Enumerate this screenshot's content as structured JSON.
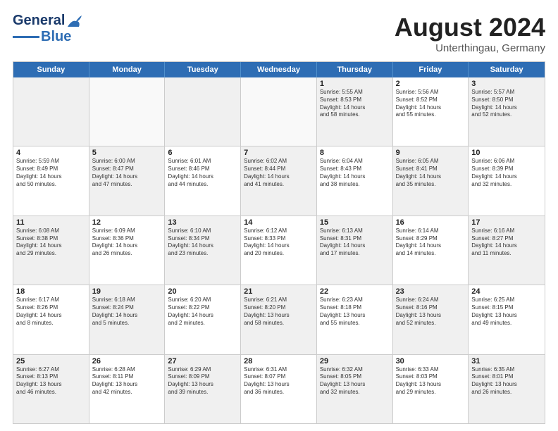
{
  "header": {
    "logo_general": "General",
    "logo_blue": "Blue",
    "main_title": "August 2024",
    "subtitle": "Unterthingau, Germany"
  },
  "days": [
    "Sunday",
    "Monday",
    "Tuesday",
    "Wednesday",
    "Thursday",
    "Friday",
    "Saturday"
  ],
  "weeks": [
    [
      {
        "num": "",
        "info": "",
        "shaded": true
      },
      {
        "num": "",
        "info": "",
        "shaded": false
      },
      {
        "num": "",
        "info": "",
        "shaded": true
      },
      {
        "num": "",
        "info": "",
        "shaded": false
      },
      {
        "num": "1",
        "info": "Sunrise: 5:55 AM\nSunset: 8:53 PM\nDaylight: 14 hours\nand 58 minutes.",
        "shaded": true
      },
      {
        "num": "2",
        "info": "Sunrise: 5:56 AM\nSunset: 8:52 PM\nDaylight: 14 hours\nand 55 minutes.",
        "shaded": false
      },
      {
        "num": "3",
        "info": "Sunrise: 5:57 AM\nSunset: 8:50 PM\nDaylight: 14 hours\nand 52 minutes.",
        "shaded": true
      }
    ],
    [
      {
        "num": "4",
        "info": "Sunrise: 5:59 AM\nSunset: 8:49 PM\nDaylight: 14 hours\nand 50 minutes.",
        "shaded": false
      },
      {
        "num": "5",
        "info": "Sunrise: 6:00 AM\nSunset: 8:47 PM\nDaylight: 14 hours\nand 47 minutes.",
        "shaded": true
      },
      {
        "num": "6",
        "info": "Sunrise: 6:01 AM\nSunset: 8:46 PM\nDaylight: 14 hours\nand 44 minutes.",
        "shaded": false
      },
      {
        "num": "7",
        "info": "Sunrise: 6:02 AM\nSunset: 8:44 PM\nDaylight: 14 hours\nand 41 minutes.",
        "shaded": true
      },
      {
        "num": "8",
        "info": "Sunrise: 6:04 AM\nSunset: 8:43 PM\nDaylight: 14 hours\nand 38 minutes.",
        "shaded": false
      },
      {
        "num": "9",
        "info": "Sunrise: 6:05 AM\nSunset: 8:41 PM\nDaylight: 14 hours\nand 35 minutes.",
        "shaded": true
      },
      {
        "num": "10",
        "info": "Sunrise: 6:06 AM\nSunset: 8:39 PM\nDaylight: 14 hours\nand 32 minutes.",
        "shaded": false
      }
    ],
    [
      {
        "num": "11",
        "info": "Sunrise: 6:08 AM\nSunset: 8:38 PM\nDaylight: 14 hours\nand 29 minutes.",
        "shaded": true
      },
      {
        "num": "12",
        "info": "Sunrise: 6:09 AM\nSunset: 8:36 PM\nDaylight: 14 hours\nand 26 minutes.",
        "shaded": false
      },
      {
        "num": "13",
        "info": "Sunrise: 6:10 AM\nSunset: 8:34 PM\nDaylight: 14 hours\nand 23 minutes.",
        "shaded": true
      },
      {
        "num": "14",
        "info": "Sunrise: 6:12 AM\nSunset: 8:33 PM\nDaylight: 14 hours\nand 20 minutes.",
        "shaded": false
      },
      {
        "num": "15",
        "info": "Sunrise: 6:13 AM\nSunset: 8:31 PM\nDaylight: 14 hours\nand 17 minutes.",
        "shaded": true
      },
      {
        "num": "16",
        "info": "Sunrise: 6:14 AM\nSunset: 8:29 PM\nDaylight: 14 hours\nand 14 minutes.",
        "shaded": false
      },
      {
        "num": "17",
        "info": "Sunrise: 6:16 AM\nSunset: 8:27 PM\nDaylight: 14 hours\nand 11 minutes.",
        "shaded": true
      }
    ],
    [
      {
        "num": "18",
        "info": "Sunrise: 6:17 AM\nSunset: 8:26 PM\nDaylight: 14 hours\nand 8 minutes.",
        "shaded": false
      },
      {
        "num": "19",
        "info": "Sunrise: 6:18 AM\nSunset: 8:24 PM\nDaylight: 14 hours\nand 5 minutes.",
        "shaded": true
      },
      {
        "num": "20",
        "info": "Sunrise: 6:20 AM\nSunset: 8:22 PM\nDaylight: 14 hours\nand 2 minutes.",
        "shaded": false
      },
      {
        "num": "21",
        "info": "Sunrise: 6:21 AM\nSunset: 8:20 PM\nDaylight: 13 hours\nand 58 minutes.",
        "shaded": true
      },
      {
        "num": "22",
        "info": "Sunrise: 6:23 AM\nSunset: 8:18 PM\nDaylight: 13 hours\nand 55 minutes.",
        "shaded": false
      },
      {
        "num": "23",
        "info": "Sunrise: 6:24 AM\nSunset: 8:16 PM\nDaylight: 13 hours\nand 52 minutes.",
        "shaded": true
      },
      {
        "num": "24",
        "info": "Sunrise: 6:25 AM\nSunset: 8:15 PM\nDaylight: 13 hours\nand 49 minutes.",
        "shaded": false
      }
    ],
    [
      {
        "num": "25",
        "info": "Sunrise: 6:27 AM\nSunset: 8:13 PM\nDaylight: 13 hours\nand 46 minutes.",
        "shaded": true
      },
      {
        "num": "26",
        "info": "Sunrise: 6:28 AM\nSunset: 8:11 PM\nDaylight: 13 hours\nand 42 minutes.",
        "shaded": false
      },
      {
        "num": "27",
        "info": "Sunrise: 6:29 AM\nSunset: 8:09 PM\nDaylight: 13 hours\nand 39 minutes.",
        "shaded": true
      },
      {
        "num": "28",
        "info": "Sunrise: 6:31 AM\nSunset: 8:07 PM\nDaylight: 13 hours\nand 36 minutes.",
        "shaded": false
      },
      {
        "num": "29",
        "info": "Sunrise: 6:32 AM\nSunset: 8:05 PM\nDaylight: 13 hours\nand 32 minutes.",
        "shaded": true
      },
      {
        "num": "30",
        "info": "Sunrise: 6:33 AM\nSunset: 8:03 PM\nDaylight: 13 hours\nand 29 minutes.",
        "shaded": false
      },
      {
        "num": "31",
        "info": "Sunrise: 6:35 AM\nSunset: 8:01 PM\nDaylight: 13 hours\nand 26 minutes.",
        "shaded": true
      }
    ]
  ]
}
